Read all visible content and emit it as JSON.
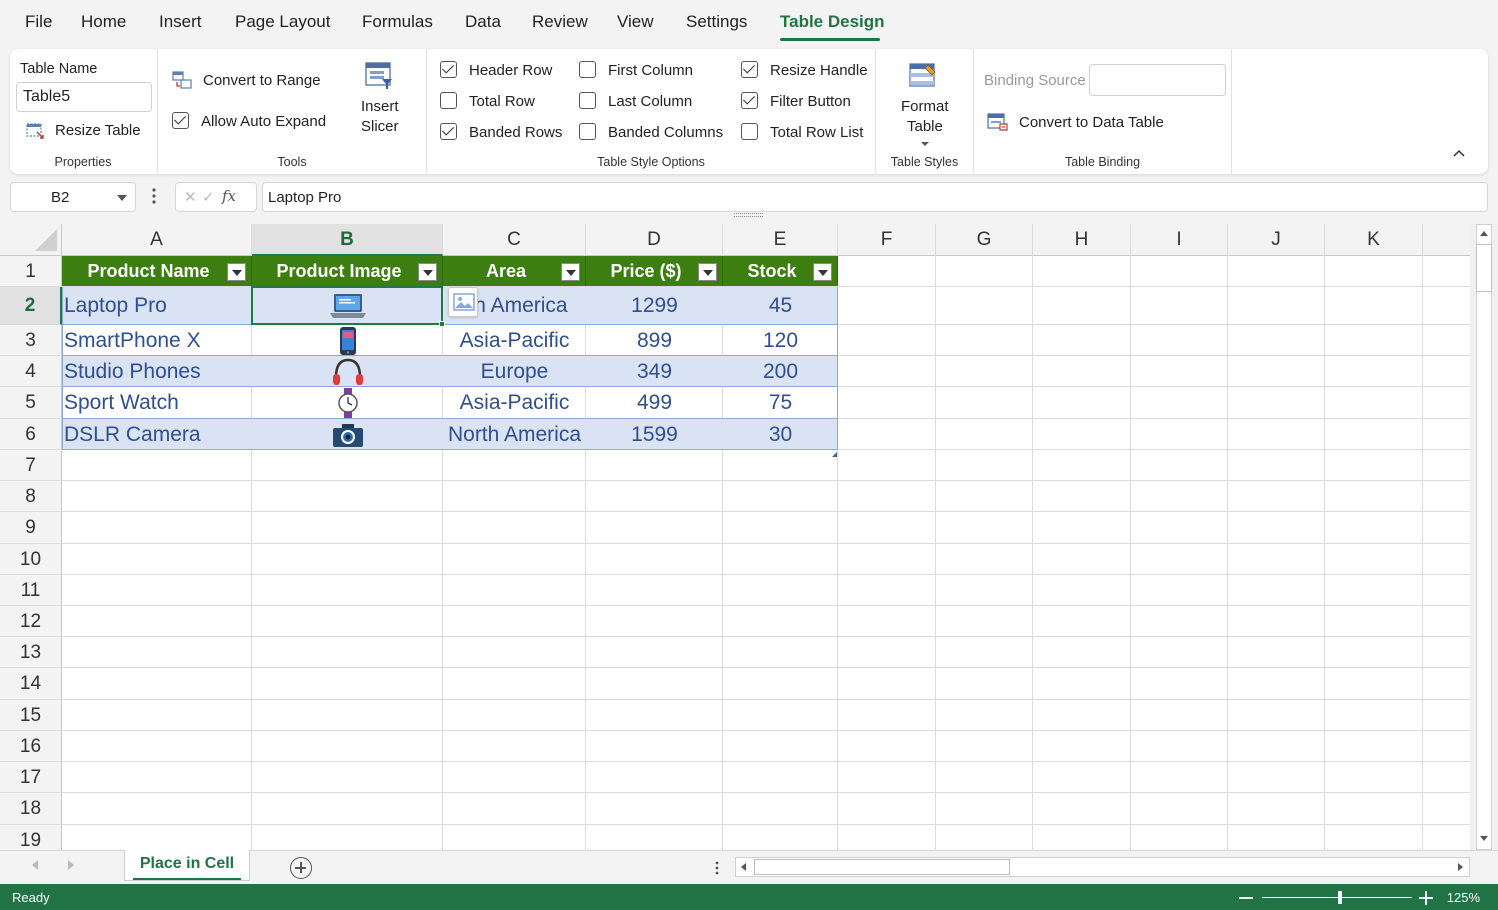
{
  "menu": {
    "tabs": [
      "File",
      "Home",
      "Insert",
      "Page Layout",
      "Formulas",
      "Data",
      "Review",
      "View",
      "Settings",
      "Table Design"
    ],
    "active": "Table Design"
  },
  "ribbon": {
    "properties": {
      "table_name_label": "Table Name",
      "table_name_value": "Table5",
      "resize_table": "Resize Table",
      "group_label": "Properties"
    },
    "tools": {
      "convert_to_range": "Convert to Range",
      "allow_auto_expand": "Allow Auto Expand",
      "allow_auto_expand_checked": true,
      "insert_slicer_line1": "Insert",
      "insert_slicer_line2": "Slicer",
      "group_label": "Tools"
    },
    "style_options": {
      "options": [
        {
          "label": "Header Row",
          "checked": true
        },
        {
          "label": "Total Row",
          "checked": false
        },
        {
          "label": "Banded Rows",
          "checked": true
        },
        {
          "label": "First Column",
          "checked": false
        },
        {
          "label": "Last Column",
          "checked": false
        },
        {
          "label": "Banded Columns",
          "checked": false
        },
        {
          "label": "Resize Handle",
          "checked": true
        },
        {
          "label": "Filter Button",
          "checked": true
        },
        {
          "label": "Total Row List",
          "checked": false
        }
      ],
      "group_label": "Table Style Options"
    },
    "table_styles": {
      "format_table_line1": "Format",
      "format_table_line2": "Table",
      "group_label": "Table Styles"
    },
    "table_binding": {
      "binding_source_label": "Binding Source",
      "convert_to_data_table": "Convert to Data Table",
      "group_label": "Table Binding"
    }
  },
  "formula_bar": {
    "name_box": "B2",
    "fx": "fx",
    "formula": "Laptop Pro"
  },
  "grid": {
    "columns": [
      "A",
      "B",
      "C",
      "D",
      "E",
      "F",
      "G",
      "H",
      "I",
      "J",
      "K"
    ],
    "selected_column": "B",
    "rows": [
      "1",
      "2",
      "3",
      "4",
      "5",
      "6",
      "7",
      "8",
      "9",
      "10",
      "11",
      "12",
      "13",
      "14",
      "15",
      "16",
      "17",
      "18",
      "19"
    ],
    "selected_row": "2",
    "table": {
      "headers": [
        "Product Name",
        "Product Image",
        "Area",
        "Price ($)",
        "Stock"
      ],
      "rows": [
        {
          "name": "Laptop Pro",
          "image": "laptop-icon",
          "area": "rth America",
          "price": "1299",
          "stock": "45"
        },
        {
          "name": "SmartPhone X",
          "image": "smartphone-icon",
          "area": "Asia-Pacific",
          "price": "899",
          "stock": "120"
        },
        {
          "name": "Studio Phones",
          "image": "headphones-icon",
          "area": "Europe",
          "price": "349",
          "stock": "200"
        },
        {
          "name": "Sport Watch",
          "image": "watch-icon",
          "area": "Asia-Pacific",
          "price": "499",
          "stock": "75"
        },
        {
          "name": "DSLR Camera",
          "image": "camera-icon",
          "area": "North America",
          "price": "1599",
          "stock": "30"
        }
      ]
    }
  },
  "sheets": {
    "active": "Place in Cell"
  },
  "status": {
    "ready": "Ready",
    "zoom": "125%"
  },
  "colors": {
    "accent": "#217346",
    "table_header": "#3c7f10",
    "band": "#dae3f3",
    "cell_text": "#2f4f8f"
  }
}
